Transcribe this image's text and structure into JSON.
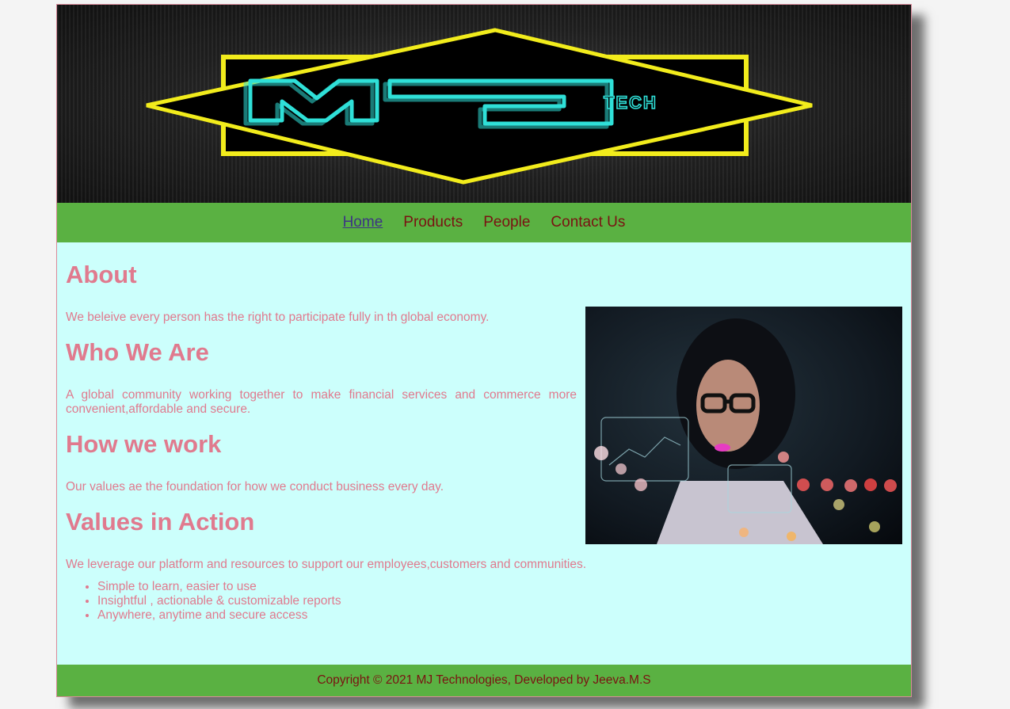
{
  "nav": {
    "items": [
      {
        "label": "Home",
        "active": true
      },
      {
        "label": "Products",
        "active": false
      },
      {
        "label": "People",
        "active": false
      },
      {
        "label": "Contact Us",
        "active": false
      }
    ]
  },
  "about": {
    "heading": "About",
    "text": "We beleive every person has the right to participate fully in th global economy."
  },
  "who": {
    "heading": "Who We Are",
    "text": "A global community working together to make financial services and commerce more convenient,affordable and secure."
  },
  "how": {
    "heading": "How we work",
    "text": "Our values ae the foundation for how we conduct business every day."
  },
  "values": {
    "heading": "Values in Action",
    "text": "We leverage our platform and resources to support our employees,customers and communities.",
    "features": [
      "Simple to learn, easier to use",
      "Insightful , actionable & customizable reports",
      "Anywhere, anytime and secure access"
    ]
  },
  "footer": {
    "text": "Copyright © 2021 MJ Technologies, Developed by Jeeva.M.S"
  },
  "logo": {
    "letters": "MJ",
    "sub": "TECH"
  },
  "colors": {
    "green": "#5ab142",
    "content_bg": "#ccfffc",
    "text_pink": "#e07a8e",
    "nav_text": "#7a1212",
    "nav_active": "#3d3584"
  }
}
